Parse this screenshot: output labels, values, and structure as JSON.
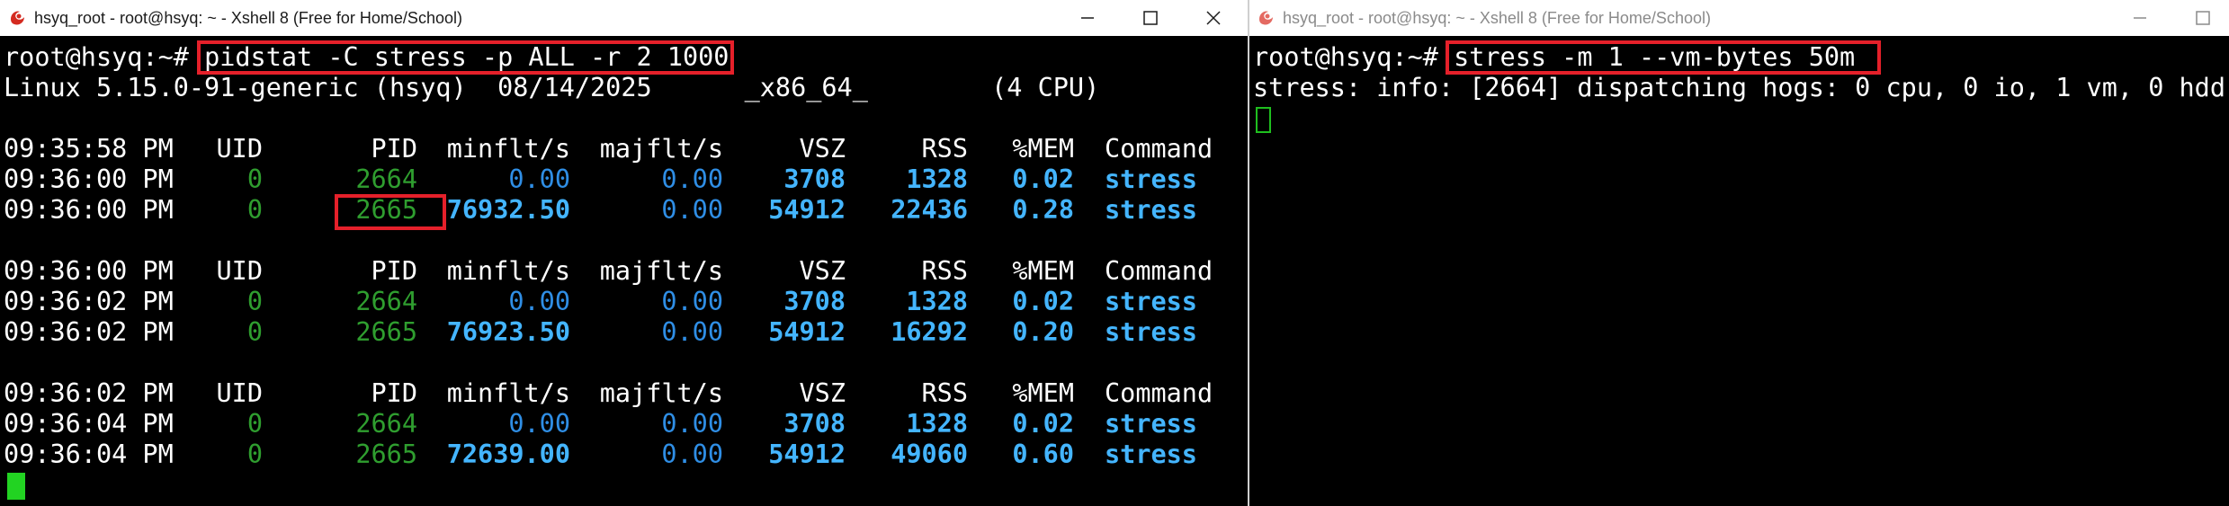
{
  "left_window": {
    "title": "hsyq_root - root@hsyq: ~ - Xshell 8 (Free for Home/School)",
    "prompt": "root@hsyq:~# ",
    "command": "pidstat -C stress -p ALL -r 2 1000",
    "sysinfo": "Linux 5.15.0-91-generic (hsyq)  08/14/2025      _x86_64_        (4 CPU)",
    "headers": [
      "UID",
      "PID",
      "minflt/s",
      "majflt/s",
      "VSZ",
      "RSS",
      "%MEM",
      "Command"
    ],
    "blocks": [
      {
        "header_time": "09:35:58 PM",
        "rows": [
          {
            "time": "09:36:00 PM",
            "uid": "0",
            "pid": "2664",
            "minflt": "0.00",
            "majflt": "0.00",
            "vsz": "3708",
            "rss": "1328",
            "mem": "0.02",
            "cmd": "stress"
          },
          {
            "time": "09:36:00 PM",
            "uid": "0",
            "pid": "2665",
            "minflt": "76932.50",
            "majflt": "0.00",
            "vsz": "54912",
            "rss": "22436",
            "mem": "0.28",
            "cmd": "stress"
          }
        ]
      },
      {
        "header_time": "09:36:00 PM",
        "rows": [
          {
            "time": "09:36:02 PM",
            "uid": "0",
            "pid": "2664",
            "minflt": "0.00",
            "majflt": "0.00",
            "vsz": "3708",
            "rss": "1328",
            "mem": "0.02",
            "cmd": "stress"
          },
          {
            "time": "09:36:02 PM",
            "uid": "0",
            "pid": "2665",
            "minflt": "76923.50",
            "majflt": "0.00",
            "vsz": "54912",
            "rss": "16292",
            "mem": "0.20",
            "cmd": "stress"
          }
        ]
      },
      {
        "header_time": "09:36:02 PM",
        "rows": [
          {
            "time": "09:36:04 PM",
            "uid": "0",
            "pid": "2664",
            "minflt": "0.00",
            "majflt": "0.00",
            "vsz": "3708",
            "rss": "1328",
            "mem": "0.02",
            "cmd": "stress"
          },
          {
            "time": "09:36:04 PM",
            "uid": "0",
            "pid": "2665",
            "minflt": "72639.00",
            "majflt": "0.00",
            "vsz": "54912",
            "rss": "49060",
            "mem": "0.60",
            "cmd": "stress"
          }
        ]
      }
    ]
  },
  "right_window": {
    "title": "hsyq_root - root@hsyq: ~ - Xshell 8 (Free for Home/School)",
    "prompt": "root@hsyq:~# ",
    "command": "stress -m 1 --vm-bytes 50m",
    "output": "stress: info: [2664] dispatching hogs: 0 cpu, 0 io, 1 vm, 0 hdd"
  },
  "icons": {
    "app": "xshell-logo-icon",
    "minimize": "minimize-icon",
    "maximize": "maximize-icon",
    "close": "close-icon"
  },
  "colors": {
    "terminal_bg": "#000000",
    "highlight_box": "#e5202a",
    "green": "#2f9e2f",
    "blue": "#2f8ee5",
    "bright_blue": "#44b5ff"
  }
}
